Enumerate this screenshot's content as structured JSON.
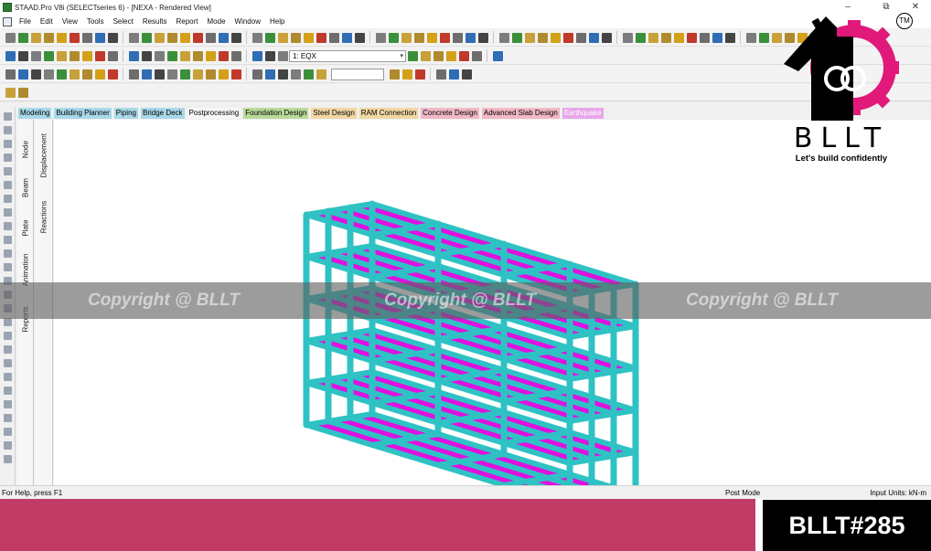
{
  "window": {
    "title": "STAAD.Pro V8i (SELECTseries 6) - [NEXA - Rendered View]",
    "minimize": "–",
    "restore": "⧉",
    "close": "✕"
  },
  "menu": [
    "File",
    "Edit",
    "View",
    "Tools",
    "Select",
    "Results",
    "Report",
    "Mode",
    "Window",
    "Help"
  ],
  "toolbar": {
    "load_case": "1: EQX",
    "load_case_icon": "dropdown-chevron",
    "input_value": ""
  },
  "page_tabs": [
    {
      "label": "Modeling",
      "color": "#a9d8e8"
    },
    {
      "label": "Building Planner",
      "color": "#a9d8e8"
    },
    {
      "label": "Piping",
      "color": "#a9d8e8"
    },
    {
      "label": "Bridge Deck",
      "color": "#a9d8e8"
    },
    {
      "label": "Postprocessing",
      "color": "#f0f0f0"
    },
    {
      "label": "Foundation Design",
      "color": "#b9d99a"
    },
    {
      "label": "Steel Design",
      "color": "#f2d7a3"
    },
    {
      "label": "RAM Connection",
      "color": "#f2d7a3"
    },
    {
      "label": "Concrete Design",
      "color": "#f2b8c6"
    },
    {
      "label": "Advanced Slab Design",
      "color": "#f2b8c6"
    },
    {
      "label": "Earthquake",
      "color": "#e7a6e8"
    }
  ],
  "side_tabs_1": [
    "Node",
    "Beam",
    "Plate",
    "Animation",
    "Reports"
  ],
  "side_tabs_2": [
    "Displacement",
    "Reactions"
  ],
  "status": {
    "help": "For Help, press F1",
    "mode": "Post Mode",
    "units": "Input Units:  kN-m"
  },
  "watermark": "Copyright @ BLLT",
  "branding": {
    "name": "BLLT",
    "tagline": "Let's build confidently",
    "trademark": "TM",
    "code": "BLLT#285",
    "accent": "#c23b66",
    "gear_color": "#e0197a"
  },
  "model": {
    "column_color": "#2fc2c4",
    "slab_color": "#e010e0"
  }
}
